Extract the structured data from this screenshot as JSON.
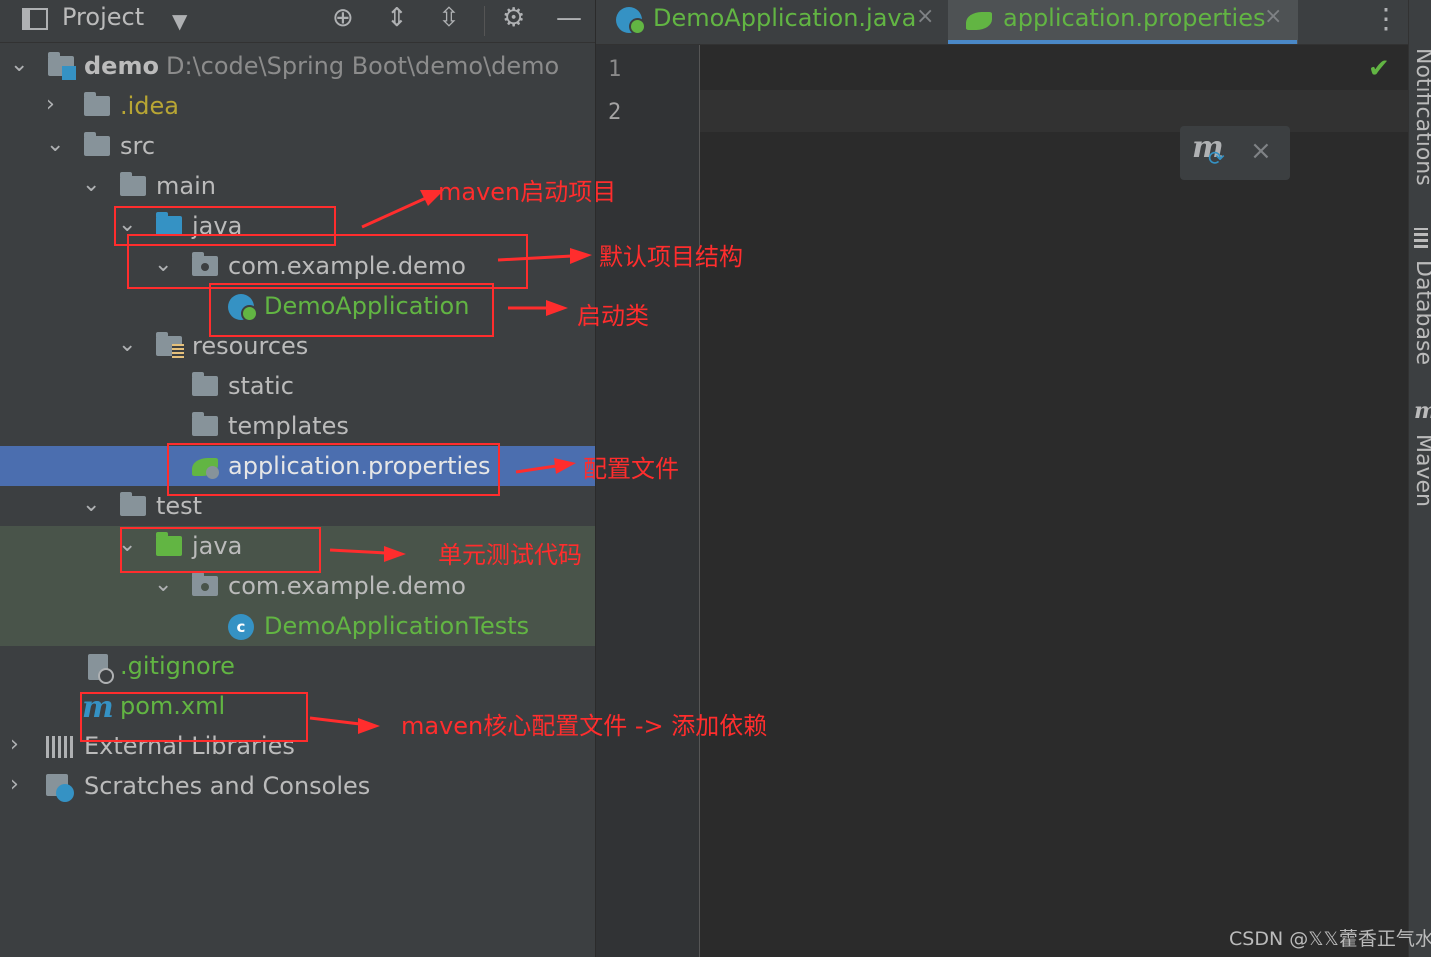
{
  "project_panel": {
    "title": "Project",
    "toolbar_icons": [
      "locate-icon",
      "expand-all-icon",
      "collapse-all-icon",
      "gear-icon",
      "minimize-icon"
    ],
    "tree": {
      "root_name": "demo",
      "root_path": "D:\\code\\Spring Boot\\demo\\demo",
      "idea": ".idea",
      "src": "src",
      "main": "main",
      "main_java": "java",
      "main_package": "com.example.demo",
      "main_class": "DemoApplication",
      "resources": "resources",
      "static": "static",
      "templates": "templates",
      "app_properties": "application.properties",
      "test": "test",
      "test_java": "java",
      "test_package": "com.example.demo",
      "test_class": "DemoApplicationTests",
      "gitignore": ".gitignore",
      "pom": "pom.xml",
      "external_libraries": "External Libraries",
      "scratches": "Scratches and Consoles"
    }
  },
  "editor": {
    "tabs": [
      {
        "label": "DemoApplication.java",
        "close": "×"
      },
      {
        "label": "application.properties",
        "close": "×"
      }
    ],
    "line_numbers": [
      "1",
      "2"
    ],
    "more_icon": "⋮",
    "check_icon": "✔",
    "maven_popup": {
      "letter": "m",
      "refresh": "⟳",
      "close": "×"
    }
  },
  "right_sidebar": {
    "tabs": [
      "Notifications",
      "Database",
      "Maven"
    ]
  },
  "annotations": {
    "maven_start": "maven启动项目",
    "default_structure": "默认项目结构",
    "startup_class": "启动类",
    "config_file": "配置文件",
    "unit_test": "单元测试代码",
    "maven_core": "maven核心配置文件 -> 添加依赖"
  },
  "watermark": "CSDN @𝕏𝕏藿香正气水",
  "colors": {
    "annotation_red": "#ff2d2d",
    "selection_blue": "#4b6eaf",
    "test_green_bg": "#49544a",
    "spring_green": "#62b543"
  }
}
